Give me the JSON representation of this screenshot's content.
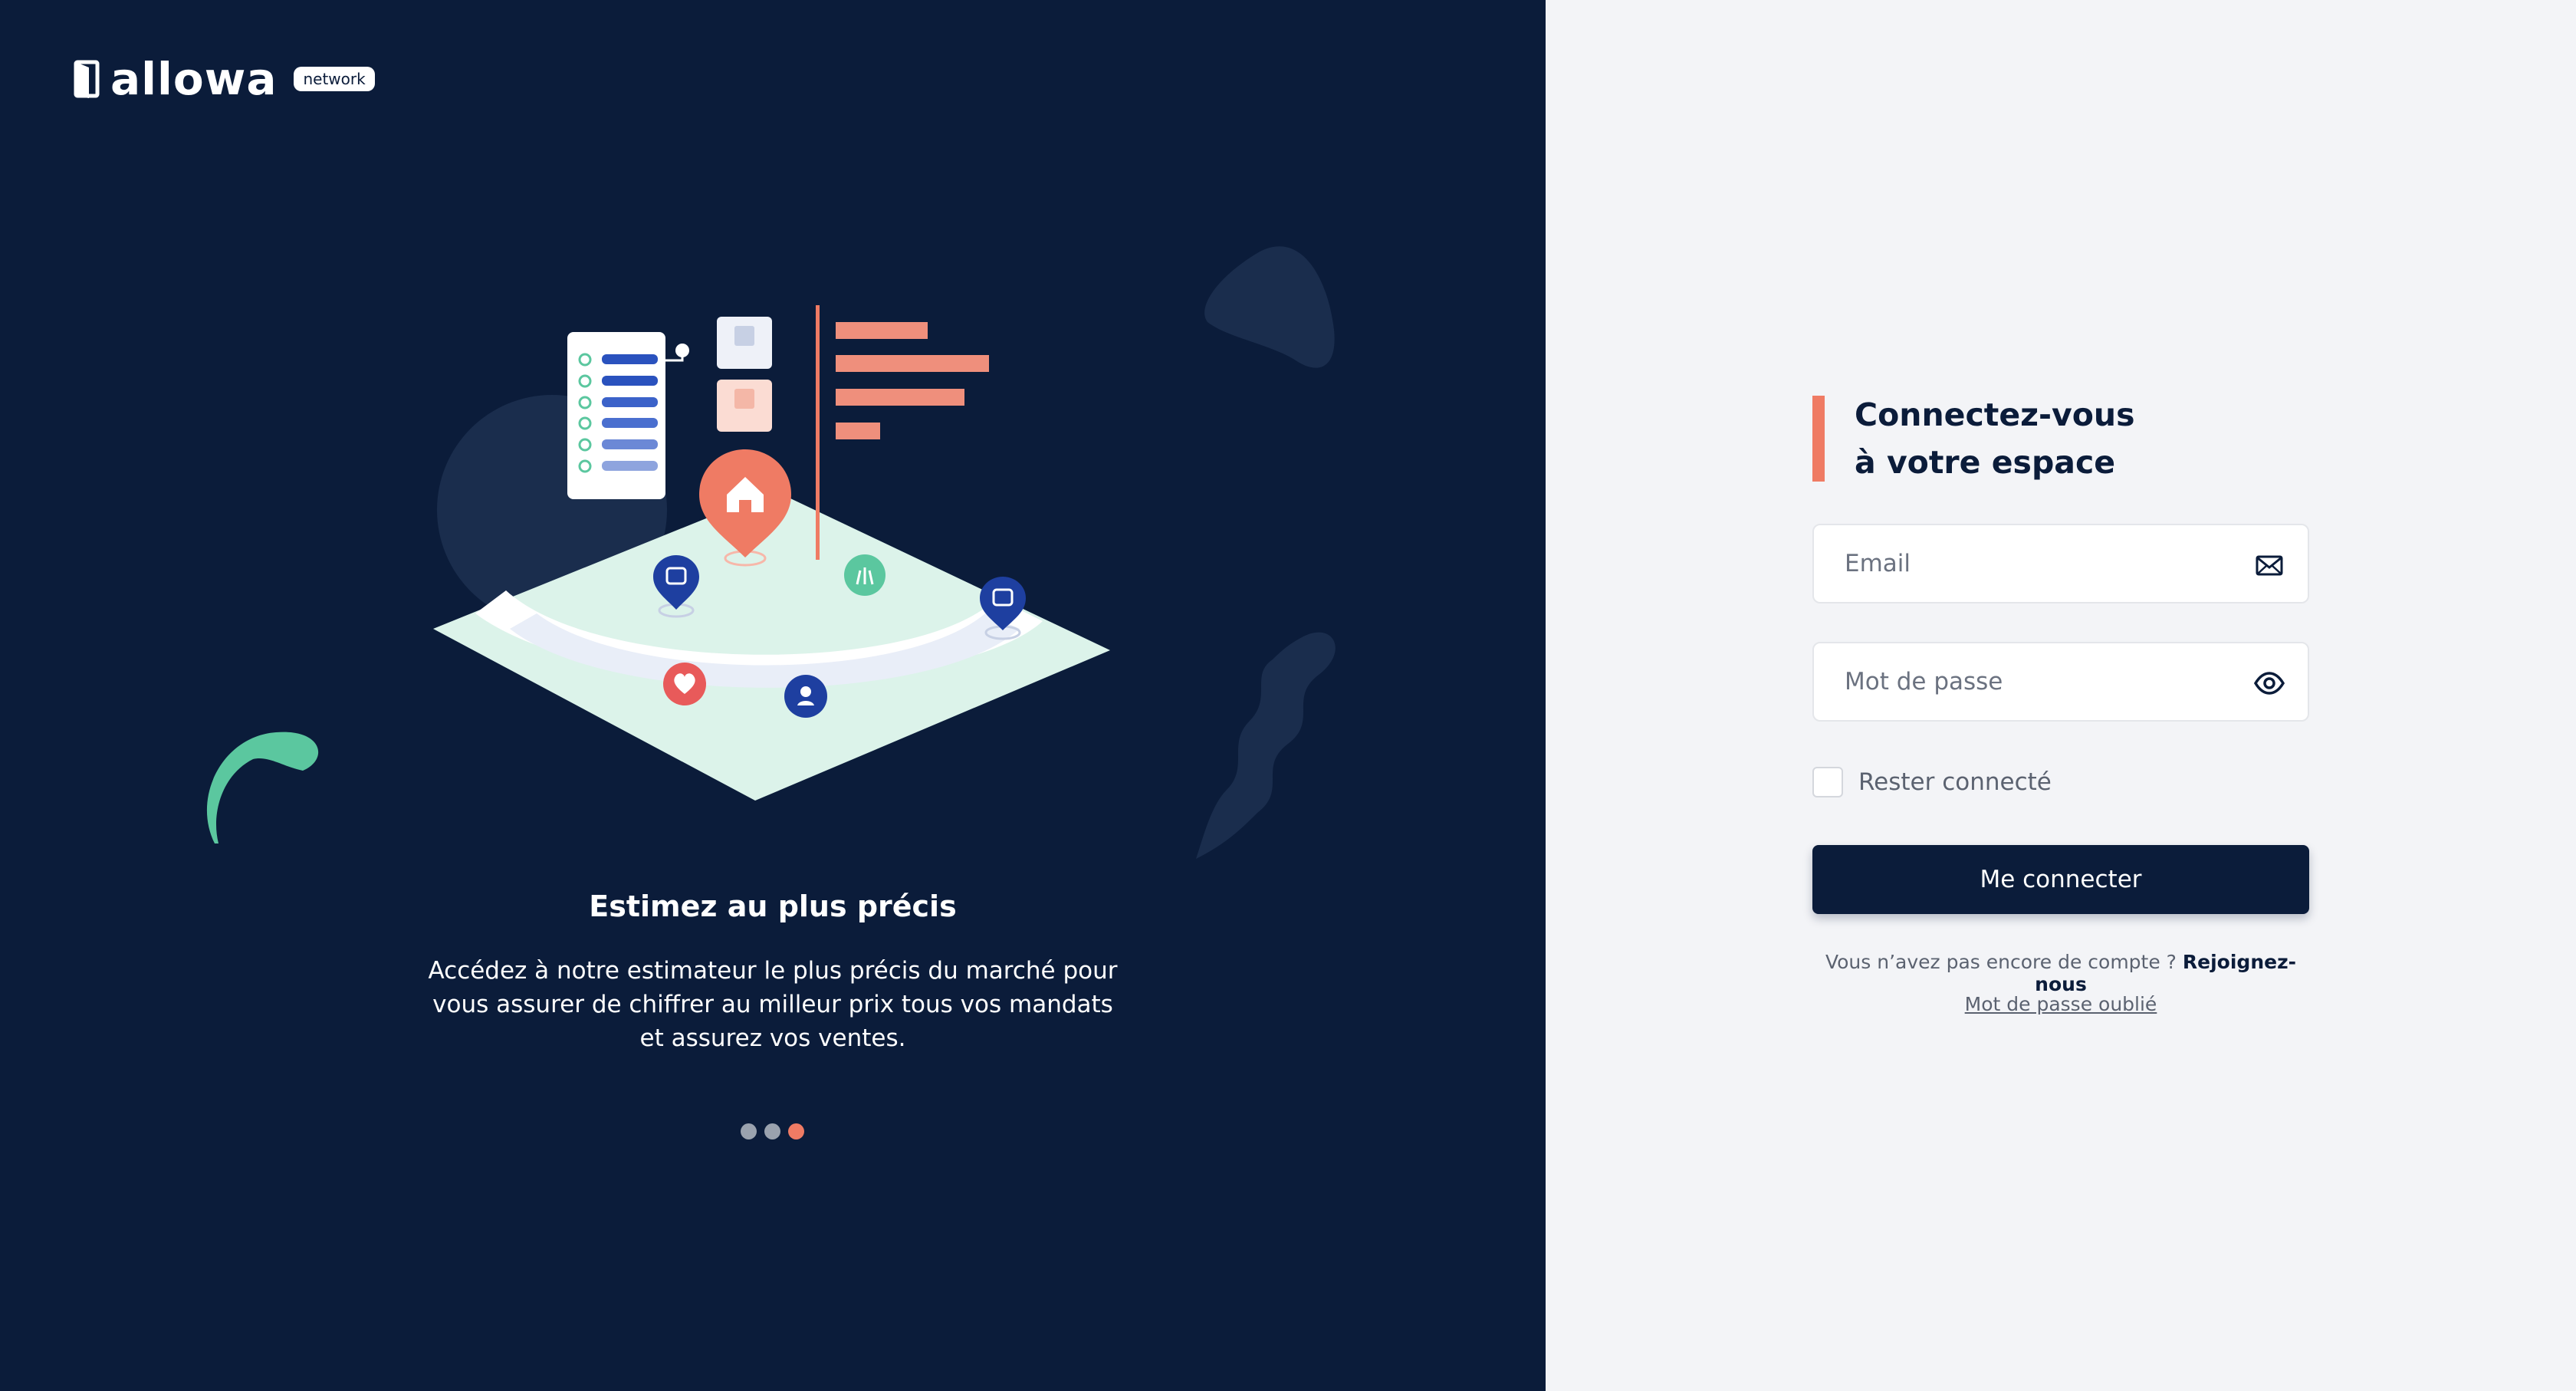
{
  "brand": {
    "name": "allowa",
    "badge": "network"
  },
  "slide": {
    "title": "Estimez au plus précis",
    "text": "Accédez à notre estimateur le plus précis du marché pour vous assurer de chiffrer au milleur prix tous vos mandats et assurez vos ventes.",
    "count": 3,
    "active_index": 2
  },
  "login": {
    "heading_line1": "Connectez-vous",
    "heading_line2": "à votre espace",
    "email_placeholder": "Email",
    "password_placeholder": "Mot de passe",
    "remember_label": "Rester connecté",
    "submit_label": "Me connecter",
    "signup_prompt": "Vous n’avez pas encore de compte ?",
    "signup_link": "Rejoignez-nous",
    "forgot_link": "Mot de passe oublié"
  },
  "colors": {
    "navy": "#0b1c3a",
    "accent": "#ef7b64",
    "mint": "#5bc79f",
    "panel_light": "#f3f4f7"
  },
  "icons": {
    "email": "envelope-icon",
    "password": "eye-icon",
    "logo": "door-icon"
  }
}
